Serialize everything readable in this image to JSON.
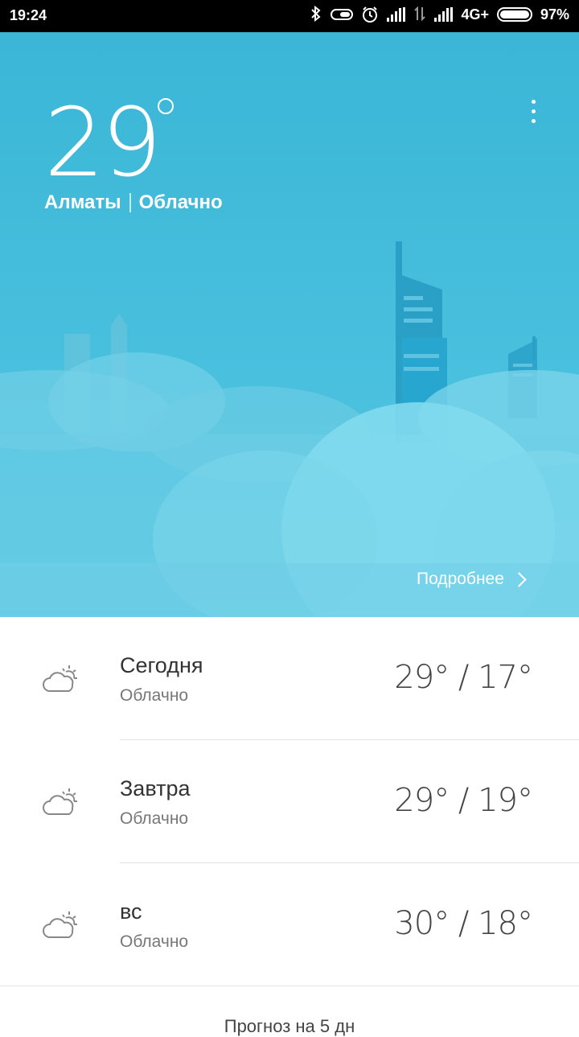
{
  "status_bar": {
    "time": "19:24",
    "network": "4G+",
    "battery": "97%"
  },
  "weather": {
    "temperature": "29",
    "city": "Алматы",
    "condition": "Облачно",
    "details_label": "Подробнее"
  },
  "forecast": [
    {
      "day": "Сегодня",
      "condition": "Облачно",
      "range": "29° / 17°",
      "icon": "partly-cloudy-icon"
    },
    {
      "day": "Завтра",
      "condition": "Облачно",
      "range": "29° / 19°",
      "icon": "partly-cloudy-icon"
    },
    {
      "day": "вс",
      "condition": "Облачно",
      "range": "30° / 18°",
      "icon": "partly-cloudy-icon"
    }
  ],
  "footer": {
    "forecast_link": "Прогноз на 5 дн"
  },
  "colors": {
    "sky": "#3bb6d6",
    "building": "#2aa0c7",
    "cloud": "#7fd6ea",
    "text_primary": "#333333",
    "text_secondary": "#777777"
  }
}
